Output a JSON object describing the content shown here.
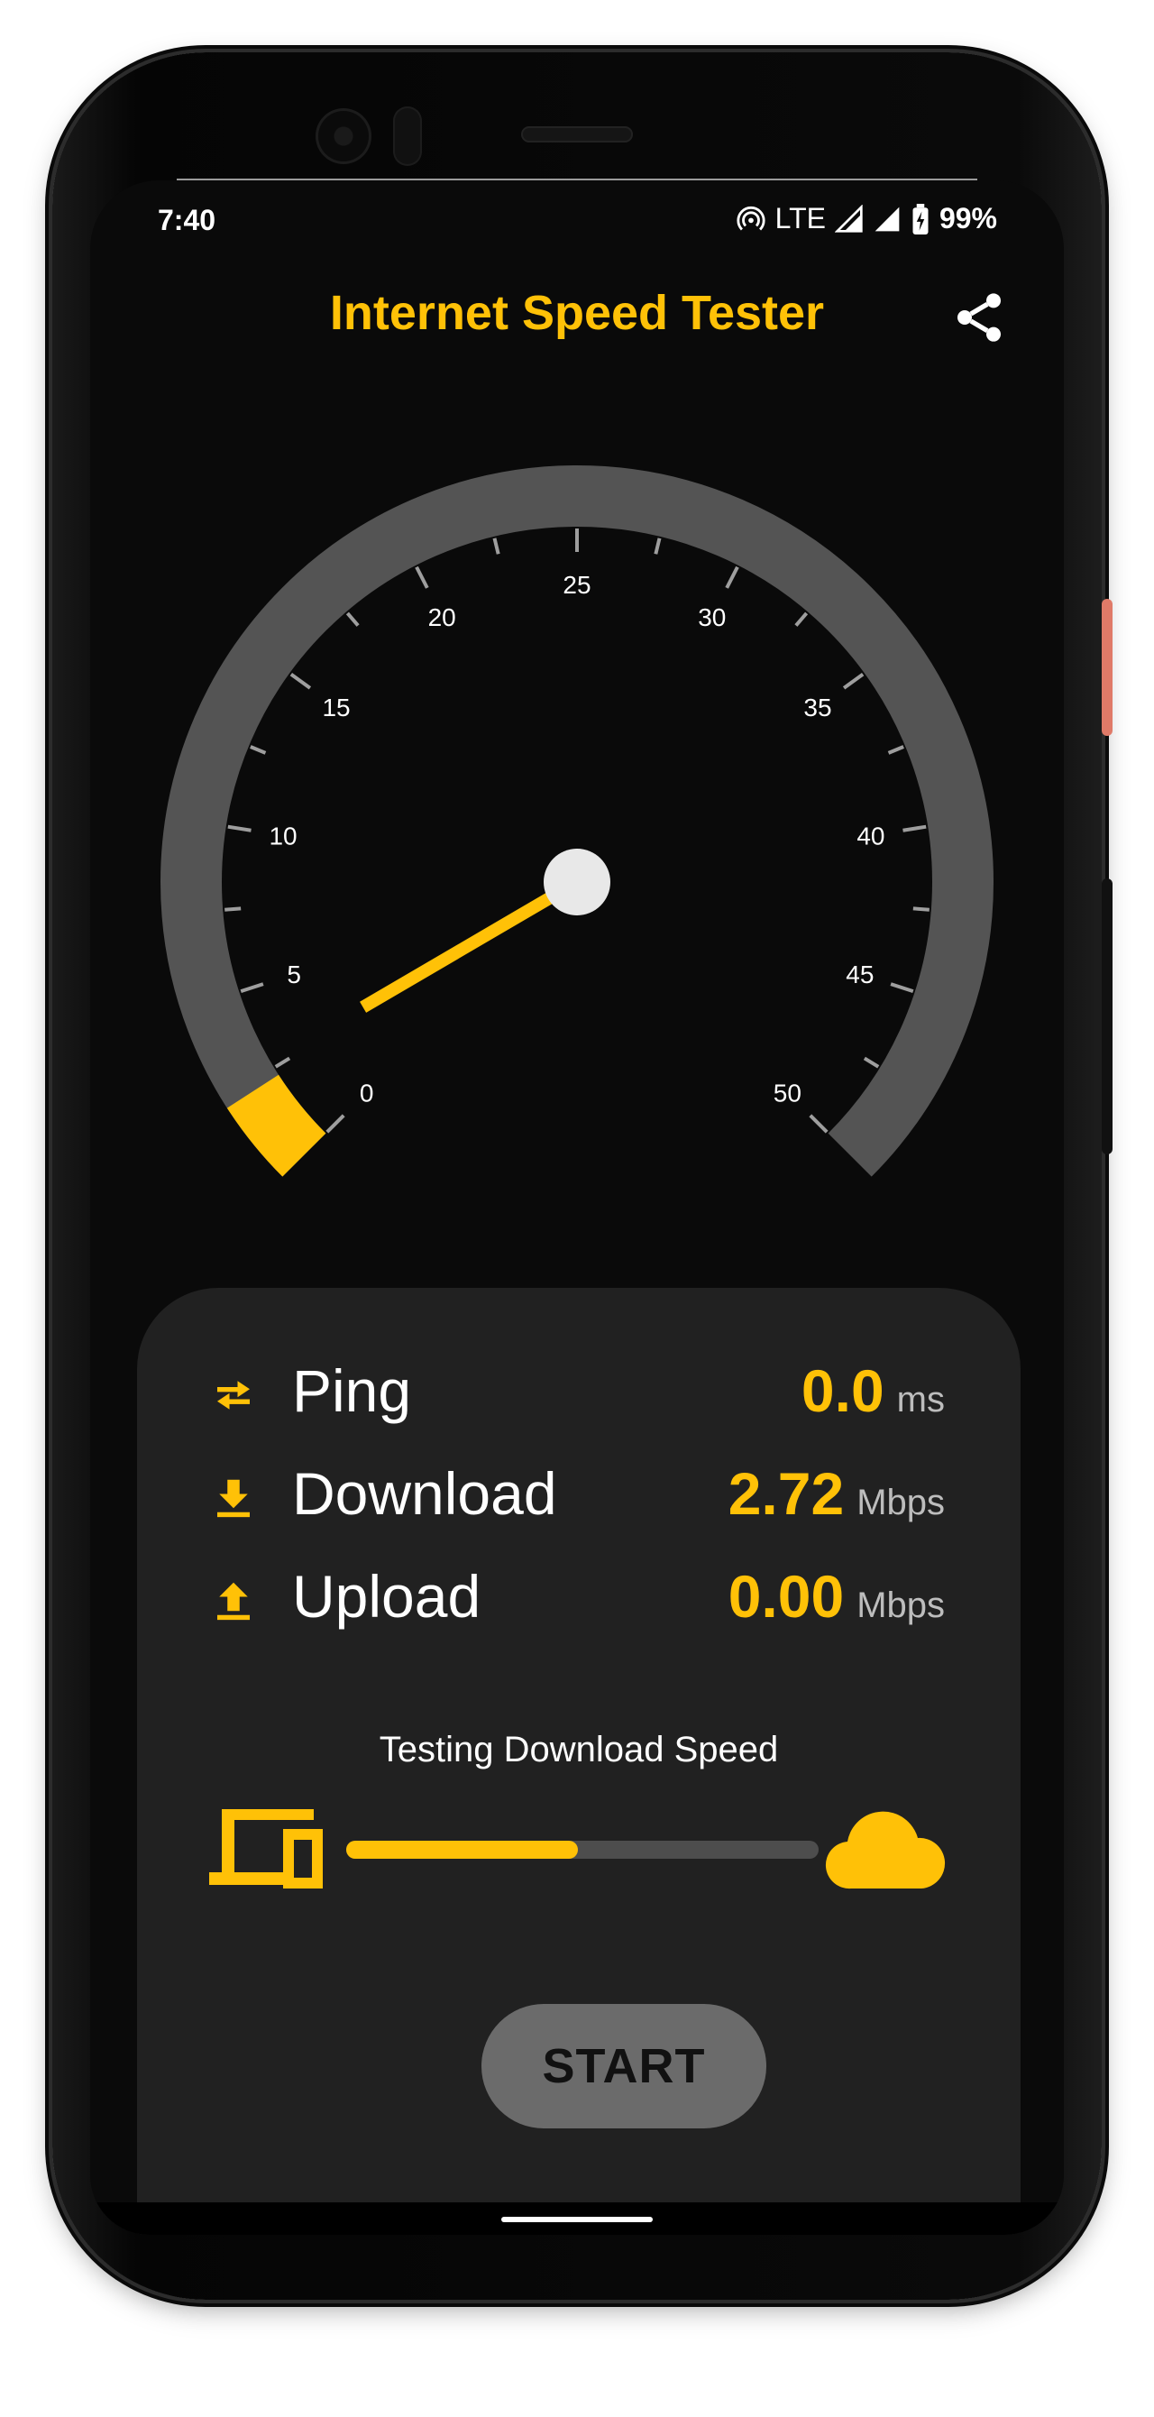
{
  "status_bar": {
    "time": "7:40",
    "network": "LTE",
    "battery": "99%"
  },
  "app": {
    "title": "Internet Speed Tester"
  },
  "gauge": {
    "min": 0,
    "max": 50,
    "tick_labels": [
      "0",
      "5",
      "10",
      "15",
      "20",
      "25",
      "30",
      "35",
      "40",
      "45",
      "50"
    ],
    "needle_value": 2.72,
    "colors": {
      "track": "#545454",
      "fill": "#ffc107",
      "needle": "#ffc107",
      "hub": "#e8e8e8",
      "ticks": "#9e9e9e",
      "labels": "#ffffff"
    }
  },
  "metrics": [
    {
      "label": "Ping",
      "value": "0.0",
      "unit": "ms",
      "icon": "swap-arrows-icon"
    },
    {
      "label": "Download",
      "value": "2.72",
      "unit": "Mbps",
      "icon": "download-icon"
    },
    {
      "label": "Upload",
      "value": "0.00",
      "unit": "Mbps",
      "icon": "upload-icon"
    }
  ],
  "test": {
    "status_text": "Testing Download Speed",
    "progress_percent": 49
  },
  "actions": {
    "start_label": "START"
  },
  "colors": {
    "accent": "#ffc107",
    "background": "#0a0a0a",
    "panel": "#212121",
    "button": "#6b6b6b"
  }
}
